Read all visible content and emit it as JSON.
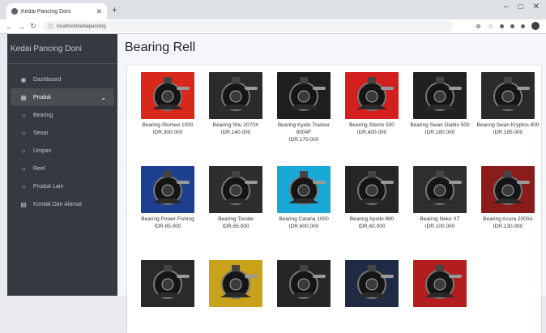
{
  "browser": {
    "tab_title": "Kedai Pancing Doni",
    "new_tab": "+",
    "address": "localhost/kedaipancing",
    "window_controls": [
      "–",
      "□",
      "✕"
    ]
  },
  "sidebar": {
    "brand": "Kedai Pancing Doni",
    "items": [
      {
        "label": "Dashboard",
        "icon": "dashboard-icon",
        "glyph": "◉"
      },
      {
        "label": "Produk",
        "icon": "box-icon",
        "glyph": "▦",
        "active": true,
        "chevron": "⌄"
      },
      {
        "label": "Bearing",
        "icon": "circle-icon",
        "glyph": "○"
      },
      {
        "label": "Senar",
        "icon": "circle-icon",
        "glyph": "○"
      },
      {
        "label": "Umpan",
        "icon": "circle-icon",
        "glyph": "○"
      },
      {
        "label": "Reel",
        "icon": "circle-icon",
        "glyph": "○"
      },
      {
        "label": "Produk Lain",
        "icon": "circle-icon",
        "glyph": "○"
      },
      {
        "label": "Kontak Dan Alamat",
        "icon": "address-card-icon",
        "glyph": "▤"
      }
    ]
  },
  "page": {
    "title": "Bearing Rell"
  },
  "products": [
    {
      "name": "Bearing Stomeo 1000",
      "price": "IDR.300.000",
      "bg": "#d8281c"
    },
    {
      "name": "Bearing Shu 2070X",
      "price": "IDR.140.000",
      "bg": "#2b2b2b"
    },
    {
      "name": "Bearing Kyoto Tracker 8004F",
      "price": "IDR.170.000",
      "bg": "#1e1e1e"
    },
    {
      "name": "Bearing Stemo 500",
      "price": "IDR.400.000",
      "bg": "#d41f1f"
    },
    {
      "name": "Bearing Swan Diablo 500",
      "price": "IDR.180.000",
      "bg": "#202020"
    },
    {
      "name": "Bearing Swan Kryptos 800",
      "price": "IDR.195.000",
      "bg": "#2a2a2a"
    },
    {
      "name": "Bearing Power Fishing",
      "price": "IDR.85.000",
      "bg": "#1d3f8f"
    },
    {
      "name": "Bearing Tonate",
      "price": "IDR.65.000",
      "bg": "#2e2e2e"
    },
    {
      "name": "Bearing Catana 1000",
      "price": "IDR.600.000",
      "bg": "#1aa8d6"
    },
    {
      "name": "Bearing Apollo 880",
      "price": "IDR.60.000",
      "bg": "#262626"
    },
    {
      "name": "Bearing Neko XT",
      "price": "IDR.100.000",
      "bg": "#2f2f2f"
    },
    {
      "name": "Bearing Acura 2000A",
      "price": "IDR.130.000",
      "bg": "#8a1c1c"
    },
    {
      "name": "",
      "price": "",
      "bg": "#2a2a2a"
    },
    {
      "name": "",
      "price": "",
      "bg": "#c9a21b"
    },
    {
      "name": "",
      "price": "",
      "bg": "#262626"
    },
    {
      "name": "",
      "price": "",
      "bg": "#1f2a44"
    },
    {
      "name": "",
      "price": "",
      "bg": "#b31d1d"
    }
  ]
}
